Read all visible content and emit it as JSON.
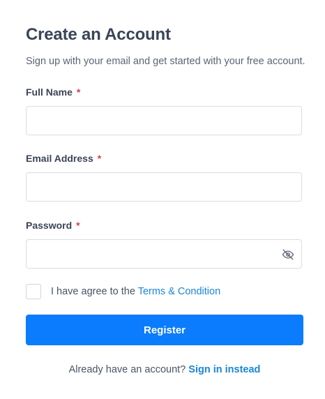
{
  "header": {
    "title": "Create an Account",
    "subtitle": "Sign up with your email and get started with your free account."
  },
  "form": {
    "full_name": {
      "label": "Full Name",
      "required_mark": "*",
      "value": "",
      "placeholder": ""
    },
    "email": {
      "label": "Email Address",
      "required_mark": "*",
      "value": "",
      "placeholder": ""
    },
    "password": {
      "label": "Password",
      "required_mark": "*",
      "value": "",
      "placeholder": "",
      "toggle_icon": "eye-slash-icon"
    },
    "terms": {
      "checked": false,
      "text": "I have agree to the ",
      "link_text": "Terms & Condition"
    },
    "submit_label": "Register"
  },
  "footer": {
    "prompt": "Already have an account? ",
    "link_text": "Sign in instead"
  },
  "colors": {
    "primary": "#0a7cfd",
    "link": "#1a86d8",
    "required": "#e0394a",
    "heading": "#3a4556"
  }
}
